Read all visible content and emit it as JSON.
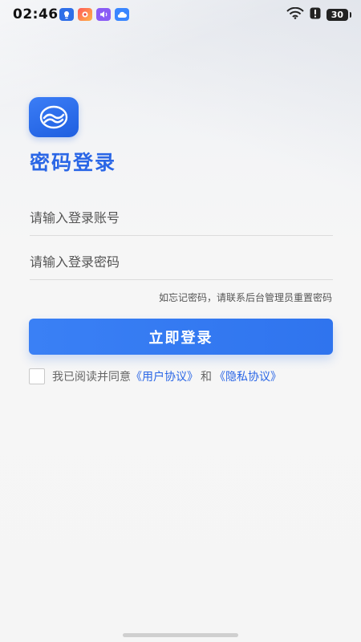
{
  "status_bar": {
    "time": "02:46",
    "battery": "30",
    "notification_icons": [
      "bulb-icon",
      "colorful-app-icon",
      "audio-icon",
      "cloud-icon"
    ],
    "system_icons": [
      "wifi-icon",
      "alert-icon",
      "battery-icon"
    ]
  },
  "login": {
    "title": "密码登录",
    "account_placeholder": "请输入登录账号",
    "password_placeholder": "请输入登录密码",
    "forgot_hint": "如忘记密码，请联系后台管理员重置密码",
    "submit_label": "立即登录"
  },
  "agreement": {
    "prefix": "我已阅读并同意",
    "user_agreement": "《用户协议》",
    "conjunction": "和",
    "privacy_agreement": "《隐私协议》"
  },
  "colors": {
    "accent": "#2f74ee",
    "title": "#2a66e6"
  }
}
